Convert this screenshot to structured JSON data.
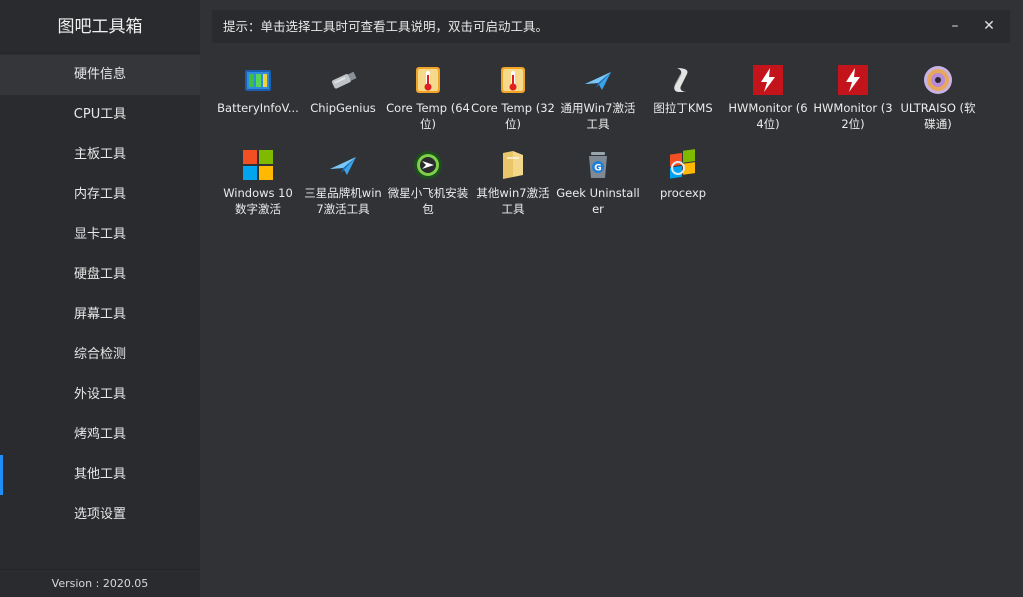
{
  "app": {
    "title": "图吧工具箱",
    "version": "Version : 2020.05"
  },
  "hint": "提示：单击选择工具时可查看工具说明，双击可启动工具。",
  "window": {
    "minimize": "–",
    "close": "✕"
  },
  "sidebar": {
    "items": [
      {
        "label": "硬件信息"
      },
      {
        "label": "CPU工具"
      },
      {
        "label": "主板工具"
      },
      {
        "label": "内存工具"
      },
      {
        "label": "显卡工具"
      },
      {
        "label": "硬盘工具"
      },
      {
        "label": "屏幕工具"
      },
      {
        "label": "综合检测"
      },
      {
        "label": "外设工具"
      },
      {
        "label": "烤鸡工具"
      },
      {
        "label": "其他工具"
      },
      {
        "label": "选项设置"
      }
    ],
    "active_index": 10
  },
  "tools": [
    {
      "label": "BatteryInfoV...",
      "icon": "battery-icon"
    },
    {
      "label": "ChipGenius",
      "icon": "usb-drive-icon"
    },
    {
      "label": "Core Temp (64位)",
      "icon": "thermometer-icon"
    },
    {
      "label": "Core Temp (32位)",
      "icon": "thermometer-icon"
    },
    {
      "label": "通用Win7激活工具",
      "icon": "paper-plane-icon"
    },
    {
      "label": "图拉丁KMS",
      "icon": "scroll-icon"
    },
    {
      "label": "HWMonitor (64位)",
      "icon": "hwmonitor-icon"
    },
    {
      "label": "HWMonitor (32位)",
      "icon": "hwmonitor-icon"
    },
    {
      "label": "ULTRAISO (软碟通)",
      "icon": "disc-icon"
    },
    {
      "label": "Windows 10 数字激活",
      "icon": "windows-logo-icon"
    },
    {
      "label": "三星品牌机win7激活工具",
      "icon": "paper-plane-icon"
    },
    {
      "label": "微星小飞机安装包",
      "icon": "afterburner-icon"
    },
    {
      "label": "其他win7激活工具",
      "icon": "folder-icon"
    },
    {
      "label": "Geek Uninstaller",
      "icon": "trash-icon"
    },
    {
      "label": "procexp",
      "icon": "process-explorer-icon"
    }
  ],
  "colors": {
    "accent": "#1f8ff5",
    "sidebar_bg": "#2a2b2e",
    "main_bg": "#313236"
  }
}
